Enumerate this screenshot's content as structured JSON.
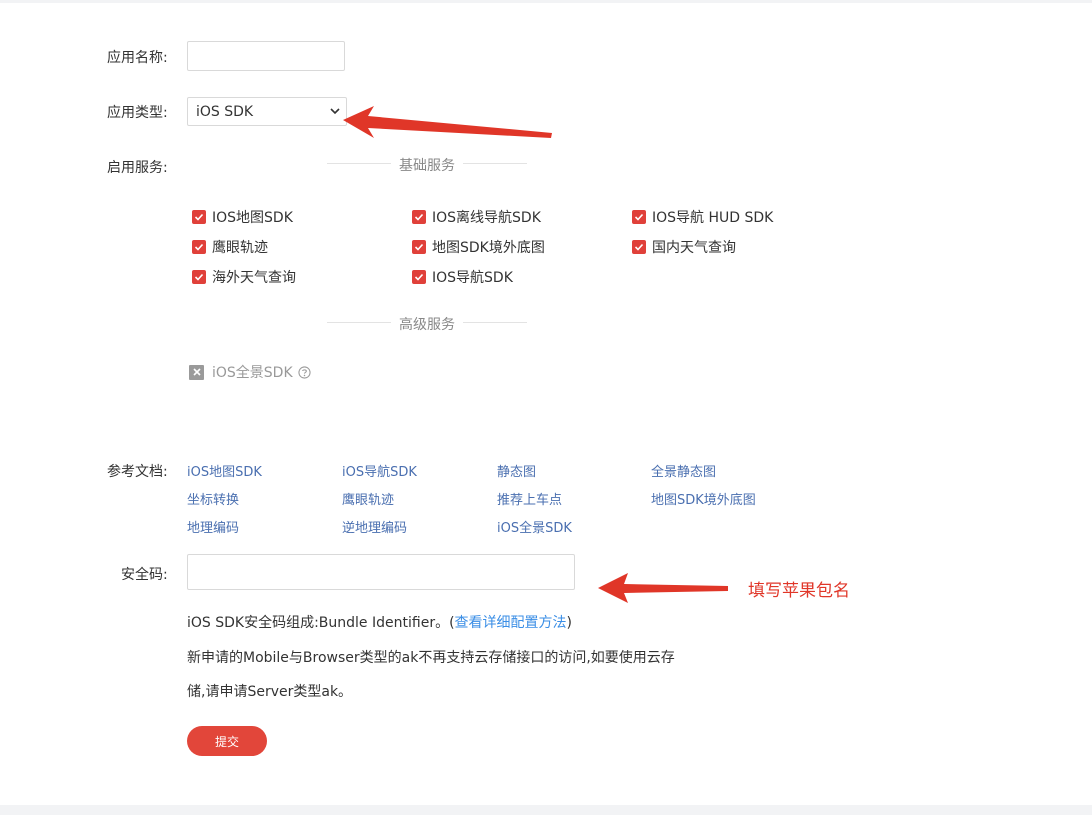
{
  "form": {
    "app_name_label": "应用名称:",
    "app_name_value": "",
    "app_type_label": "应用类型:",
    "app_type_value": "iOS SDK",
    "services_label": "启用服务:",
    "basic_services_title": "基础服务",
    "basic_services": [
      {
        "label": "IOS地图SDK",
        "checked": true
      },
      {
        "label": "IOS离线导航SDK",
        "checked": true
      },
      {
        "label": "IOS导航 HUD SDK",
        "checked": true
      },
      {
        "label": "鹰眼轨迹",
        "checked": true
      },
      {
        "label": "地图SDK境外底图",
        "checked": true
      },
      {
        "label": "国内天气查询",
        "checked": true
      },
      {
        "label": "海外天气查询",
        "checked": true
      },
      {
        "label": "IOS导航SDK",
        "checked": true
      }
    ],
    "advanced_services_title": "高级服务",
    "advanced_services": [
      {
        "label": "iOS全景SDK",
        "checked": false,
        "disabled": true
      }
    ],
    "docs_label": "参考文档:",
    "docs": [
      "iOS地图SDK",
      "iOS导航SDK",
      "静态图",
      "全景静态图",
      "坐标转换",
      "鹰眼轨迹",
      "推荐上车点",
      "地图SDK境外底图",
      "地理编码",
      "逆地理编码",
      "iOS全景SDK"
    ],
    "security_code_label": "安全码:",
    "security_code_value": "",
    "note_prefix": "iOS SDK安全码组成:Bundle Identifier。(",
    "note_link": "查看详细配置方法",
    "note_suffix": ")",
    "notice_line1": "新申请的Mobile与Browser类型的ak不再支持云存储接口的访问,如要使用云存",
    "notice_line2": "储,请申请Server类型ak。",
    "submit_label": "提交"
  },
  "annotations": {
    "bundle_hint": "填写苹果包名"
  },
  "colors": {
    "accent": "#e2463a",
    "link": "#4a6fb0",
    "annotation": "#e03628"
  },
  "icons": {
    "select_chevron": "chevron-down-icon",
    "checkbox": "check-icon",
    "disabled_checkbox": "x-box-icon",
    "help": "question-circle-icon",
    "arrows": "arrow-left-icon"
  }
}
